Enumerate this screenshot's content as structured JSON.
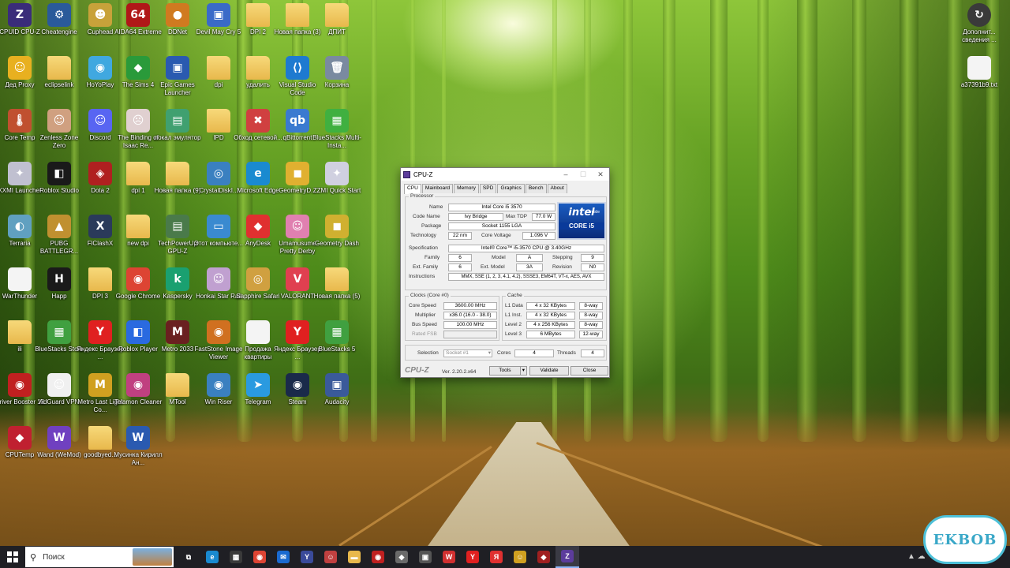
{
  "desktop": {
    "icons": [
      {
        "label": "CPUID CPU-Z",
        "color": "#3a2c7a",
        "glyph": "Z"
      },
      {
        "label": "Cheatengine",
        "color": "#2a5a9a",
        "glyph": "⚙"
      },
      {
        "label": "Cuphead",
        "color": "#c8a23a",
        "glyph": "☻"
      },
      {
        "label": "AIDA64 Extreme",
        "color": "#b01818",
        "glyph": "64"
      },
      {
        "label": "DDNet",
        "color": "#d07a20",
        "glyph": "●"
      },
      {
        "label": "Devil May Cry 5",
        "color": "#3a6ac8",
        "glyph": "▣"
      },
      {
        "label": "DPI 2",
        "color": "folder",
        "glyph": ""
      },
      {
        "label": "Новая папка (3)",
        "color": "folder",
        "glyph": ""
      },
      {
        "label": "ДПИТ",
        "color": "folder",
        "glyph": ""
      },
      {
        "label": "Дед Proxy",
        "color": "#e8b020",
        "glyph": "☺"
      },
      {
        "label": "eclipselink",
        "color": "folder",
        "glyph": ""
      },
      {
        "label": "HoYoPlay",
        "color": "#40a8e0",
        "glyph": "◉"
      },
      {
        "label": "The Sims 4",
        "color": "#2a9a3a",
        "glyph": "◆"
      },
      {
        "label": "Epic Games Launcher",
        "color": "#2a5ab0",
        "glyph": "▣"
      },
      {
        "label": "dpi",
        "color": "folder",
        "glyph": ""
      },
      {
        "label": "удалить",
        "color": "folder",
        "glyph": ""
      },
      {
        "label": "Visual Studio Code",
        "color": "#1e7ad0",
        "glyph": "⟨⟩"
      },
      {
        "label": "Корзина",
        "color": "#7a8aa0",
        "glyph": "🗑"
      },
      {
        "label": "Core Temp",
        "color": "#c05030",
        "glyph": "🌡"
      },
      {
        "label": "Zenless Zone Zero",
        "color": "#d0a080",
        "glyph": "☺"
      },
      {
        "label": "Discord",
        "color": "#5865f2",
        "glyph": "☺"
      },
      {
        "label": "The Binding of Isaac Re...",
        "color": "#e0d0d0",
        "glyph": "☹"
      },
      {
        "label": "локал эмулятор",
        "color": "#40a070",
        "glyph": "▤"
      },
      {
        "label": "IPD",
        "color": "folder",
        "glyph": ""
      },
      {
        "label": "Обход сетевой...",
        "color": "#d04040",
        "glyph": "✖"
      },
      {
        "label": "qBittorrent",
        "color": "#3a7ad0",
        "glyph": "qb"
      },
      {
        "label": "BlueStacks Multi-Insta...",
        "color": "#40b040",
        "glyph": "▦"
      },
      {
        "label": "XXMI Launcher",
        "color": "#c0c0d0",
        "glyph": "✦"
      },
      {
        "label": "Roblox Studio",
        "color": "#1a1a1a",
        "glyph": "◧"
      },
      {
        "label": "Dota 2",
        "color": "#b02020",
        "glyph": "◈"
      },
      {
        "label": "dpi 1",
        "color": "folder",
        "glyph": ""
      },
      {
        "label": "Новая папка (9)",
        "color": "folder",
        "glyph": ""
      },
      {
        "label": "CrystalDiskI...",
        "color": "#3a80c0",
        "glyph": "◎"
      },
      {
        "label": "Microsoft Edge",
        "color": "#1a8ad0",
        "glyph": "e"
      },
      {
        "label": "GeometryD...",
        "color": "#e0b030",
        "glyph": "◼"
      },
      {
        "label": "ZZMI Quick Start",
        "color": "#d0d0e0",
        "glyph": "✦"
      },
      {
        "label": "Terraria",
        "color": "#60a0c0",
        "glyph": "◐"
      },
      {
        "label": "PUBG BATTLEGR...",
        "color": "#c09030",
        "glyph": "▲"
      },
      {
        "label": "FlClashX",
        "color": "#2a3a5a",
        "glyph": "X"
      },
      {
        "label": "new dpi",
        "color": "folder",
        "glyph": ""
      },
      {
        "label": "TechPowerUp GPU-Z",
        "color": "#4a7a4a",
        "glyph": "▤"
      },
      {
        "label": "Этот компьюте...",
        "color": "#3a8ad0",
        "glyph": "▭"
      },
      {
        "label": "AnyDesk",
        "color": "#e03030",
        "glyph": "◆"
      },
      {
        "label": "Umamusume Pretty Derby",
        "color": "#e080b0",
        "glyph": "☺"
      },
      {
        "label": "Geometry Dash",
        "color": "#d0b030",
        "glyph": "◼"
      },
      {
        "label": "WarThunder",
        "color": "doc",
        "glyph": ""
      },
      {
        "label": "Happ",
        "color": "#1a1a1a",
        "glyph": "H"
      },
      {
        "label": "DPI 3",
        "color": "folder",
        "glyph": ""
      },
      {
        "label": "Google Chrome",
        "color": "#dd4433",
        "glyph": "◉"
      },
      {
        "label": "Kaspersky",
        "color": "#1aa070",
        "glyph": "k"
      },
      {
        "label": "Honkai Star Rail",
        "color": "#c0a0d0",
        "glyph": "☺"
      },
      {
        "label": "Sapphire Safari",
        "color": "#d0a040",
        "glyph": "◎"
      },
      {
        "label": "VALORANT",
        "color": "#e04050",
        "glyph": "V"
      },
      {
        "label": "Новая папка (5)",
        "color": "folder",
        "glyph": ""
      },
      {
        "label": "ili",
        "color": "folder",
        "glyph": ""
      },
      {
        "label": "BlueStacks Store",
        "color": "#40a040",
        "glyph": "▦"
      },
      {
        "label": "Яндекс Браузер ...",
        "color": "#e02020",
        "glyph": "Y"
      },
      {
        "label": "Roblox Player",
        "color": "#2a6ae0",
        "glyph": "◧"
      },
      {
        "label": "Metro 2033",
        "color": "#6a2020",
        "glyph": "M"
      },
      {
        "label": "FastStone Image Viewer",
        "color": "#d07020",
        "glyph": "◉"
      },
      {
        "label": "Продажа квартиры",
        "color": "doc",
        "glyph": ""
      },
      {
        "label": "Яндекс Браузер ...",
        "color": "#e02020",
        "glyph": "Y"
      },
      {
        "label": "BlueStacks 5",
        "color": "#40a040",
        "glyph": "▦"
      },
      {
        "label": "Driver Booster 12",
        "color": "#c02020",
        "glyph": "◉"
      },
      {
        "label": "AdGuard VPN",
        "color": "#f0f0f0",
        "glyph": "☺"
      },
      {
        "label": "Metro Last Light Co...",
        "color": "#d0a020",
        "glyph": "M"
      },
      {
        "label": "Telamon Cleaner",
        "color": "#c04080",
        "glyph": "◉"
      },
      {
        "label": "MTool",
        "color": "folder",
        "glyph": ""
      },
      {
        "label": "Win Riser",
        "color": "#3a80c0",
        "glyph": "◉"
      },
      {
        "label": "Telegram",
        "color": "#2a9ae0",
        "glyph": "➤"
      },
      {
        "label": "Steam",
        "color": "#1a2a4a",
        "glyph": "◉"
      },
      {
        "label": "Audacity",
        "color": "#3a5a9a",
        "glyph": "▣"
      },
      {
        "label": "CPUTemp",
        "color": "#c02030",
        "glyph": "◆"
      },
      {
        "label": "Wand (WeMod)",
        "color": "#7040c0",
        "glyph": "W"
      },
      {
        "label": "goodbyed...",
        "color": "folder",
        "glyph": ""
      },
      {
        "label": "Мусинка Кирилл Ан...",
        "color": "#2a5ab0",
        "glyph": "W"
      }
    ],
    "right_icons": [
      {
        "label": "Дополнит... сведения ...",
        "color": "#3a3a3a",
        "glyph": "↻"
      },
      {
        "label": "a37391b9.txt",
        "color": "doc",
        "glyph": ""
      }
    ]
  },
  "cpuz": {
    "title": "CPU-Z",
    "tabs": [
      "CPU",
      "Mainboard",
      "Memory",
      "SPD",
      "Graphics",
      "Bench",
      "About"
    ],
    "processor_legend": "Processor",
    "name_label": "Name",
    "name": "Intel Core i5 3570",
    "codename_label": "Code Name",
    "codename": "Ivy Bridge",
    "maxtdp_label": "Max TDP",
    "maxtdp": "77.0 W",
    "package_label": "Package",
    "package": "Socket 1155 LGA",
    "technology_label": "Technology",
    "technology": "22 nm",
    "corevoltage_label": "Core Voltage",
    "corevoltage": "1.096 V",
    "spec_label": "Specification",
    "spec": "Intel® Core™ i5-3570 CPU @ 3.40GHz",
    "family_label": "Family",
    "family": "6",
    "model_label": "Model",
    "model": "A",
    "stepping_label": "Stepping",
    "stepping": "9",
    "extfamily_label": "Ext. Family",
    "extfamily": "6",
    "extmodel_label": "Ext. Model",
    "extmodel": "3A",
    "revision_label": "Revision",
    "revision": "N0",
    "instructions_label": "Instructions",
    "instructions": "MMX, SSE (1, 2, 3, 4.1, 4.2), SSSE3, EM64T, VT-x, AES, AVX",
    "intel_logo": {
      "top": "intel",
      "sub": "inside",
      "bottom": "CORE i5"
    },
    "clocks_legend": "Clocks (Core #0)",
    "corespeed_label": "Core Speed",
    "corespeed": "3600.00 MHz",
    "multiplier_label": "Multiplier",
    "multiplier": "x36.0 (16.0 - 38.0)",
    "busspeed_label": "Bus Speed",
    "busspeed": "100.00 MHz",
    "ratedfsb_label": "Rated FSB",
    "ratedfsb": "",
    "cache_legend": "Cache",
    "l1d_label": "L1 Data",
    "l1d": "4 x 32 KBytes",
    "l1d_way": "8-way",
    "l1i_label": "L1 Inst.",
    "l1i": "4 x 32 KBytes",
    "l1i_way": "8-way",
    "l2_label": "Level 2",
    "l2": "4 x 256 KBytes",
    "l2_way": "8-way",
    "l3_label": "Level 3",
    "l3": "6 MBytes",
    "l3_way": "12-way",
    "selection_label": "Selection",
    "selection": "Socket #1",
    "cores_label": "Cores",
    "cores": "4",
    "threads_label": "Threads",
    "threads": "4",
    "brand": "CPU-Z",
    "version": "Ver. 2.20.2.x64",
    "tools": "Tools",
    "validate": "Validate",
    "close": "Close"
  },
  "taskbar": {
    "search_placeholder": "Поиск",
    "apps": [
      {
        "name": "task-view",
        "glyph": "⧉",
        "color": "#1f1f24"
      },
      {
        "name": "edge",
        "glyph": "e",
        "color": "#1a8ad0"
      },
      {
        "name": "store",
        "glyph": "▦",
        "color": "#3a3a3a"
      },
      {
        "name": "chrome",
        "glyph": "◉",
        "color": "#dd4433"
      },
      {
        "name": "mail",
        "glyph": "✉",
        "color": "#1a6ad0"
      },
      {
        "name": "yandex-music",
        "glyph": "Y",
        "color": "#3a4a9a"
      },
      {
        "name": "games",
        "glyph": "☺",
        "color": "#c04040"
      },
      {
        "name": "explorer",
        "glyph": "▬",
        "color": "#e8b84c"
      },
      {
        "name": "driver-booster",
        "glyph": "◉",
        "color": "#c02020"
      },
      {
        "name": "app-box",
        "glyph": "◆",
        "color": "#6a6a6a"
      },
      {
        "name": "app-gray",
        "glyph": "▣",
        "color": "#555"
      },
      {
        "name": "wps",
        "glyph": "W",
        "color": "#d03030"
      },
      {
        "name": "yandex-browser",
        "glyph": "Y",
        "color": "#e02020"
      },
      {
        "name": "yandex",
        "glyph": "Я",
        "color": "#e03030"
      },
      {
        "name": "app-yellow",
        "glyph": "☺",
        "color": "#d0a020"
      },
      {
        "name": "app-red",
        "glyph": "◆",
        "color": "#a02020"
      },
      {
        "name": "cpu-z",
        "glyph": "Z",
        "color": "#5c3c9c"
      }
    ]
  },
  "watermark": "EKBOB"
}
